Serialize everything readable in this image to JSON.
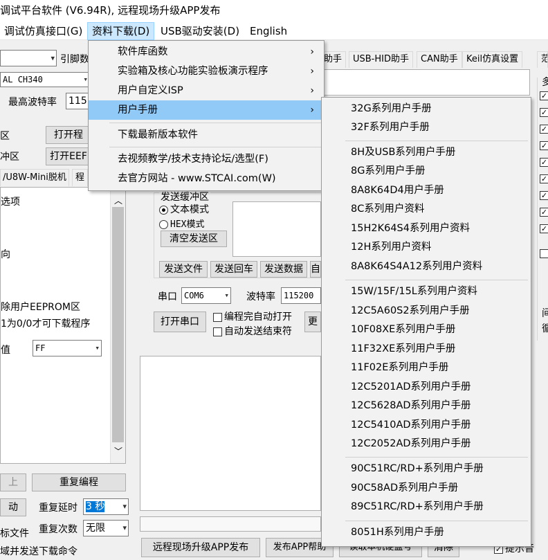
{
  "window": {
    "title": "调试平台软件 (V6.94R), 远程现场升级APP发布"
  },
  "menubar": {
    "items": [
      {
        "label": "调试仿真接口(G)"
      },
      {
        "label": "资料下载(D)"
      },
      {
        "label": "USB驱动安装(D)"
      },
      {
        "label": "English"
      }
    ]
  },
  "left_panel": {
    "pin_label": "引脚数",
    "port_value": "CH340",
    "port_prefix": "AL",
    "max_baud_label": "最高波特率",
    "max_baud_value": "115",
    "open_prog_button": "打开程",
    "open_eep_button": "打开EEF",
    "area1": "区",
    "area2": "冲区",
    "tab_offline": "/U8W-Mini脱机",
    "tab_prog": "程",
    "options_title": "选项",
    "opt_direction": "向",
    "opt_erase_eeprom": "除用户EEPROM区",
    "opt_download_cond": "1为0/0才可下载程序",
    "value_label": "值",
    "value_select": "FF",
    "bottom_up_button": "上",
    "reprogram_button": "重复编程",
    "auto_label": "动",
    "repeat_delay_label": "重复延时",
    "repeat_delay_value": "3 秒",
    "repeat_count_label": "重复次数",
    "repeat_count_value": "无限",
    "file_label": "标文件",
    "send_download_cmd": "域并发送下载命令"
  },
  "tabs": [
    {
      "label": "助手"
    },
    {
      "label": "USB-HID助手"
    },
    {
      "label": "CAN助手"
    },
    {
      "label": "Keil仿真设置"
    },
    {
      "label": "范"
    }
  ],
  "serial": {
    "send_buffer_title": "发送缓冲区",
    "text_mode": "文本模式",
    "hex_mode": "HEX模式",
    "clear_send_button": "清空发送区",
    "send_file_button": "发送文件",
    "send_return_button": "发送回车",
    "send_data_button": "发送数据",
    "auto_button": "自",
    "port_label": "串口",
    "port_value": "COM6",
    "baud_label": "波特率",
    "baud_value": "115200",
    "open_port_button": "打开串口",
    "auto_open_label": "编程完自动打开",
    "auto_send_end_label": "自动发送结束符",
    "more_button": "更"
  },
  "right_strip": {
    "title": "多",
    "text1": "间",
    "text2": "循"
  },
  "bottom_bar": {
    "remote_upgrade_button": "远程现场升级APP发布",
    "publish_help_button": "发布APP帮助",
    "read_disk_button": "读取本机硬盘号",
    "clear_button": "清除",
    "beep_label": "提示音"
  },
  "dropdown_menu": {
    "items": [
      {
        "label": "软件库函数",
        "submenu": true
      },
      {
        "label": "实验箱及核心功能实验板演示程序",
        "submenu": true
      },
      {
        "label": "用户自定义ISP",
        "submenu": true
      },
      {
        "label": "用户手册",
        "submenu": true,
        "highlighted": true
      },
      {
        "label": "下载最新版本软件",
        "submenu": false
      },
      {
        "label": "去视频教学/技术支持论坛/选型(F)",
        "submenu": false
      },
      {
        "label": "去官方网站 - www.STCAI.com(W)",
        "submenu": false
      }
    ]
  },
  "submenu": {
    "items": [
      "32G系列用户手册",
      "32F系列用户手册",
      "8H及USB系列用户手册",
      "8G系列用户手册",
      "8A8K64D4用户手册",
      "8C系列用户资料",
      "15H2K64S4系列用户资料",
      "12H系列用户资料",
      "8A8K64S4A12系列用户资料",
      "15W/15F/15L系列用户资料",
      "12C5A60S2系列用户手册",
      "10F08XE系列用户手册",
      "11F32XE系列用户手册",
      "11F02E系列用户手册",
      "12C5201AD系列用户手册",
      "12C5628AD系列用户手册",
      "12C5410AD系列用户手册",
      "12C2052AD系列用户手册",
      "90C51RC/RD+系列用户手册",
      "90C58AD系列用户手册",
      "89C51RC/RD+系列用户手册",
      "8051H系列用户手册"
    ]
  },
  "icons": {
    "arrow_right": "chevron-right-icon",
    "arrow_down": "chevron-down-icon",
    "scroll_up": "scroll-up-icon",
    "scroll_down": "scroll-down-icon"
  },
  "colors": {
    "menu_highlight": "#91c9f7",
    "menubar_active": "#cce8ff",
    "window_bg": "#f0f0f0"
  }
}
